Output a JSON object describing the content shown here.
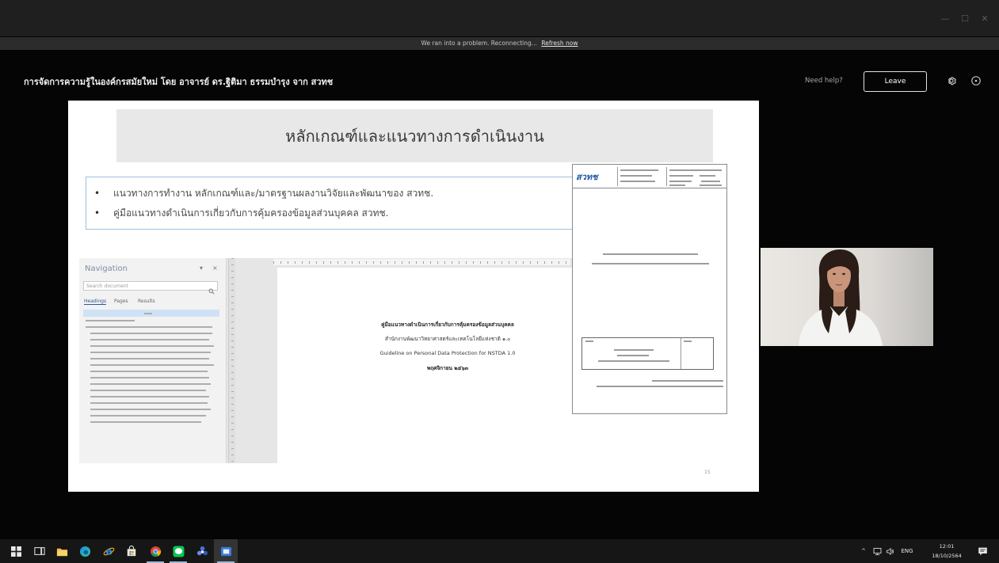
{
  "window": {
    "minimize": "—",
    "maximize": "☐",
    "close": "✕"
  },
  "banner": {
    "message": "We ran into a problem. Reconnecting...",
    "link": "Refresh now"
  },
  "header": {
    "meeting_title": "การจัดการความรู้ในองค์กรสมัยใหม่ โดย อาจารย์ ดร.ฐิติมา ธรรมบำรุง จาก สวทช",
    "help_label": "Need help?",
    "leave_label": "Leave",
    "icons": [
      "gear-icon",
      "info-icon"
    ]
  },
  "slide": {
    "title": "หลักเกณฑ์และแนวทางการดำเนินงาน",
    "bullet_glyph": "•",
    "bullets": [
      "แนวทางการทำงาน หลักเกณฑ์และ/มาตรฐานผลงานวิจัยและพัฒนาของ สวทช.",
      "คู่มือแนวทางดำเนินการเกี่ยวกับการคุ้มครองข้อมูลส่วนบุคคล สวทช."
    ],
    "page_number": "15",
    "colors": {
      "title_box": "#e8e8e8",
      "bullet_border": "#9fc0e3",
      "logo": "#2256a8"
    },
    "word_doc": {
      "navigation": {
        "title": "Navigation",
        "controls": [
          "▾",
          "×"
        ],
        "search_placeholder": "Search document",
        "tabs": [
          "Headings",
          "Pages",
          "Results"
        ],
        "active_tab_index": 0
      },
      "page_lines": [
        "คู่มือแนวทางดำเนินการเกี่ยวกับการคุ้มครองข้อมูลส่วนบุคคล",
        "สำนักงานพัฒนาวิทยาศาสตร์และเทคโนโลยีแห่งชาติ ๑.๐",
        "Guideline on Personal Data Protection for NSTDA 1.0",
        "พฤศจิกายน ๒๕๖๓"
      ]
    },
    "cover_doc": {
      "logo_text": "สวทช"
    }
  },
  "presenter": {
    "icon": "presenter-video"
  },
  "taskbar": {
    "apps": [
      "windows-start-icon",
      "task-view-icon",
      "file-explorer-icon",
      "edge-icon",
      "internet-explorer-icon",
      "store-icon",
      "chrome-icon",
      "line-icon",
      "blue-app-icon",
      "teams-icon"
    ],
    "tray": {
      "chevron": "^",
      "language": "ENG",
      "time": "12:01",
      "date": "18/10/2564"
    }
  }
}
